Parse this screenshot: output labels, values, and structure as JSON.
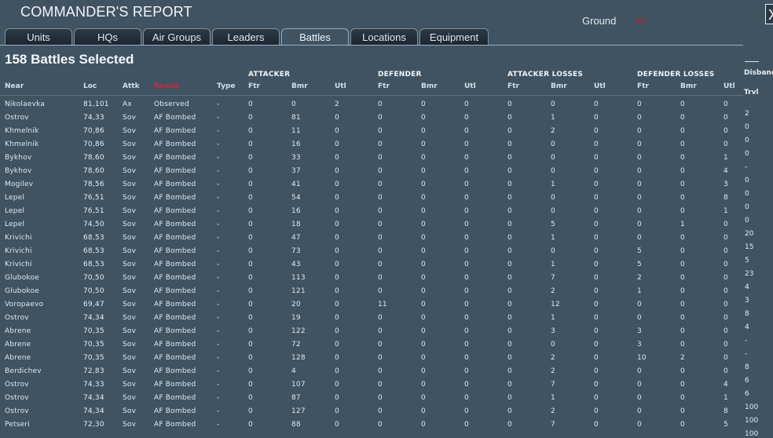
{
  "window": {
    "title": "COMMANDER'S REPORT",
    "close_glyph": "X"
  },
  "filter": {
    "label": "Ground",
    "value": "All"
  },
  "tabs": [
    {
      "label": "Units",
      "active": false
    },
    {
      "label": "HQs",
      "active": false
    },
    {
      "label": "Air Groups",
      "active": false
    },
    {
      "label": "Leaders",
      "active": false
    },
    {
      "label": "Battles",
      "active": true
    },
    {
      "label": "Locations",
      "active": false
    },
    {
      "label": "Equipment",
      "active": false
    }
  ],
  "summary": "158 Battles Selected",
  "groups": [
    "ATTACKER",
    "DEFENDER",
    "ATTACKER LOSSES",
    "DEFENDER LOSSES"
  ],
  "columns": [
    "Near",
    "Loc",
    "Attk",
    "Result",
    "Type",
    "Ftr",
    "Bmr",
    "Utl",
    "Ftr",
    "Bmr",
    "Utl",
    "Ftr",
    "Bmr",
    "Utl",
    "Ftr",
    "Bmr",
    "Utl"
  ],
  "sorted_column": "Result",
  "rows": [
    [
      "Nikolaevka",
      "81,101",
      "Ax",
      "Observed",
      "-",
      "0",
      "0",
      "2",
      "0",
      "0",
      "0",
      "0",
      "0",
      "0",
      "0",
      "0",
      "0"
    ],
    [
      "Ostrov",
      "74,33",
      "Sov",
      "AF Bombed",
      "-",
      "0",
      "81",
      "0",
      "0",
      "0",
      "0",
      "0",
      "1",
      "0",
      "0",
      "0",
      "0"
    ],
    [
      "Khmelnik",
      "70,86",
      "Sov",
      "AF Bombed",
      "-",
      "0",
      "11",
      "0",
      "0",
      "0",
      "0",
      "0",
      "2",
      "0",
      "0",
      "0",
      "0"
    ],
    [
      "Khmelnik",
      "70,86",
      "Sov",
      "AF Bombed",
      "-",
      "0",
      "16",
      "0",
      "0",
      "0",
      "0",
      "0",
      "0",
      "0",
      "0",
      "0",
      "0"
    ],
    [
      "Bykhov",
      "78,60",
      "Sov",
      "AF Bombed",
      "-",
      "0",
      "33",
      "0",
      "0",
      "0",
      "0",
      "0",
      "0",
      "0",
      "0",
      "0",
      "1"
    ],
    [
      "Bykhov",
      "78,60",
      "Sov",
      "AF Bombed",
      "-",
      "0",
      "37",
      "0",
      "0",
      "0",
      "0",
      "0",
      "0",
      "0",
      "0",
      "0",
      "4"
    ],
    [
      "Mogilev",
      "78,56",
      "Sov",
      "AF Bombed",
      "-",
      "0",
      "41",
      "0",
      "0",
      "0",
      "0",
      "0",
      "1",
      "0",
      "0",
      "0",
      "3"
    ],
    [
      "Lepel",
      "76,51",
      "Sov",
      "AF Bombed",
      "-",
      "0",
      "54",
      "0",
      "0",
      "0",
      "0",
      "0",
      "0",
      "0",
      "0",
      "0",
      "8"
    ],
    [
      "Lepel",
      "76,51",
      "Sov",
      "AF Bombed",
      "-",
      "0",
      "16",
      "0",
      "0",
      "0",
      "0",
      "0",
      "0",
      "0",
      "0",
      "0",
      "1"
    ],
    [
      "Lepel",
      "74,50",
      "Sov",
      "AF Bombed",
      "-",
      "0",
      "18",
      "0",
      "0",
      "0",
      "0",
      "0",
      "5",
      "0",
      "0",
      "1",
      "0"
    ],
    [
      "Krivichi",
      "68,53",
      "Sov",
      "AF Bombed",
      "-",
      "0",
      "47",
      "0",
      "0",
      "0",
      "0",
      "0",
      "1",
      "0",
      "0",
      "0",
      "0"
    ],
    [
      "Krivichi",
      "68,53",
      "Sov",
      "AF Bombed",
      "-",
      "0",
      "73",
      "0",
      "0",
      "0",
      "0",
      "0",
      "0",
      "0",
      "5",
      "0",
      "0"
    ],
    [
      "Krivichi",
      "68,53",
      "Sov",
      "AF Bombed",
      "-",
      "0",
      "43",
      "0",
      "0",
      "0",
      "0",
      "0",
      "1",
      "0",
      "5",
      "0",
      "0"
    ],
    [
      "Glubokoe",
      "70,50",
      "Sov",
      "AF Bombed",
      "-",
      "0",
      "113",
      "0",
      "0",
      "0",
      "0",
      "0",
      "7",
      "0",
      "2",
      "0",
      "0"
    ],
    [
      "Glubokoe",
      "70,50",
      "Sov",
      "AF Bombed",
      "-",
      "0",
      "121",
      "0",
      "0",
      "0",
      "0",
      "0",
      "2",
      "0",
      "1",
      "0",
      "0"
    ],
    [
      "Voropaevo",
      "69,47",
      "Sov",
      "AF Bombed",
      "-",
      "0",
      "20",
      "0",
      "11",
      "0",
      "0",
      "0",
      "12",
      "0",
      "0",
      "0",
      "0"
    ],
    [
      "Ostrov",
      "74,34",
      "Sov",
      "AF Bombed",
      "-",
      "0",
      "19",
      "0",
      "0",
      "0",
      "0",
      "0",
      "1",
      "0",
      "0",
      "0",
      "0"
    ],
    [
      "Abrene",
      "70,35",
      "Sov",
      "AF Bombed",
      "-",
      "0",
      "122",
      "0",
      "0",
      "0",
      "0",
      "0",
      "3",
      "0",
      "3",
      "0",
      "0"
    ],
    [
      "Abrene",
      "70,35",
      "Sov",
      "AF Bombed",
      "-",
      "0",
      "72",
      "0",
      "0",
      "0",
      "0",
      "0",
      "0",
      "0",
      "3",
      "0",
      "0"
    ],
    [
      "Abrene",
      "70,35",
      "Sov",
      "AF Bombed",
      "-",
      "0",
      "128",
      "0",
      "0",
      "0",
      "0",
      "0",
      "2",
      "0",
      "10",
      "2",
      "0"
    ],
    [
      "Berdichev",
      "72,83",
      "Sov",
      "AF Bombed",
      "-",
      "0",
      "4",
      "0",
      "0",
      "0",
      "0",
      "0",
      "2",
      "0",
      "0",
      "0",
      "0"
    ],
    [
      "Ostrov",
      "74,33",
      "Sov",
      "AF Bombed",
      "-",
      "0",
      "107",
      "0",
      "0",
      "0",
      "0",
      "0",
      "7",
      "0",
      "0",
      "0",
      "4"
    ],
    [
      "Ostrov",
      "74,34",
      "Sov",
      "AF Bombed",
      "-",
      "0",
      "87",
      "0",
      "0",
      "0",
      "0",
      "0",
      "1",
      "0",
      "0",
      "0",
      "1"
    ],
    [
      "Ostrov",
      "74,34",
      "Sov",
      "AF Bombed",
      "-",
      "0",
      "127",
      "0",
      "0",
      "0",
      "0",
      "0",
      "2",
      "0",
      "0",
      "0",
      "8"
    ],
    [
      "Petseri",
      "72,30",
      "Sov",
      "AF Bombed",
      "-",
      "0",
      "88",
      "0",
      "0",
      "0",
      "0",
      "0",
      "7",
      "0",
      "0",
      "0",
      "5"
    ]
  ],
  "side_panel": {
    "header": "Disband",
    "column": "Trvl",
    "values": [
      "2",
      "0",
      "0",
      "0",
      "-",
      "0",
      "0",
      "0",
      "0",
      "20",
      "15",
      "5",
      "23",
      "4",
      "3",
      "8",
      "4",
      "-",
      "-",
      "8",
      "6",
      "6",
      "100",
      "100",
      "100"
    ]
  },
  "colors": {
    "background": "#3f5363",
    "sorted_header": "#d4253a",
    "result_text": "#c0202a"
  }
}
